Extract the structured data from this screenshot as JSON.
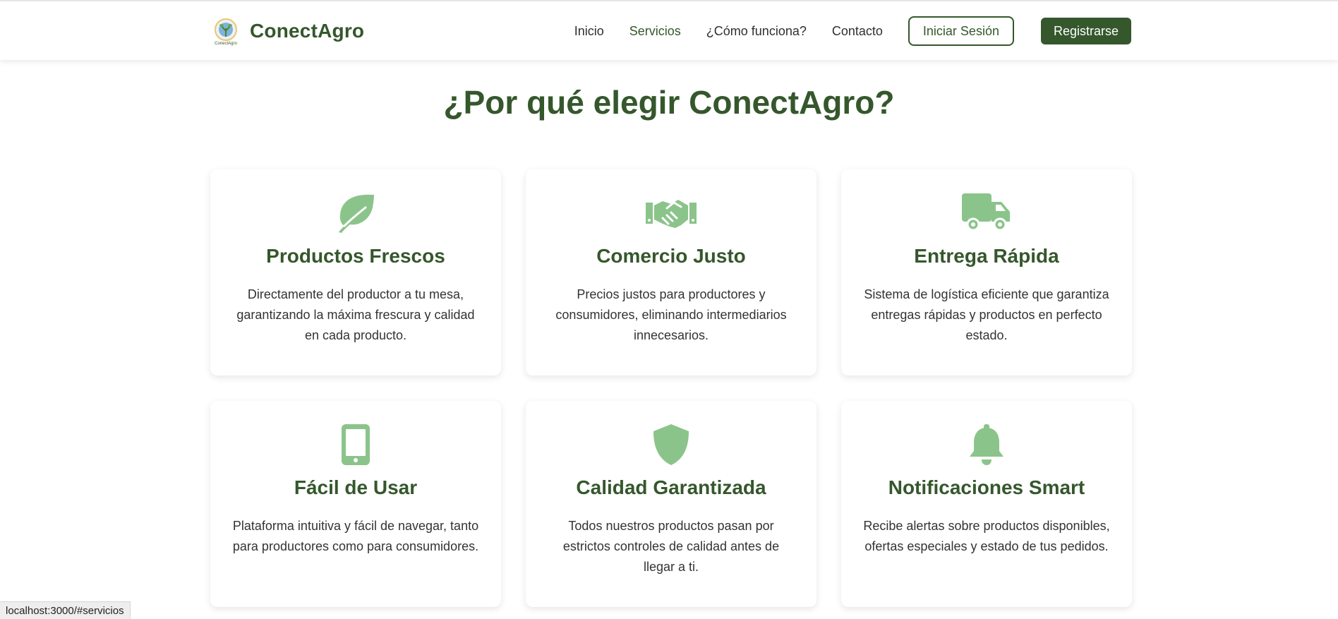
{
  "brand": {
    "name": "ConectAgro",
    "logo_text": "ConectAgro"
  },
  "nav": {
    "links": [
      "Inicio",
      "Servicios",
      "¿Cómo funciona?",
      "Contacto"
    ],
    "active": "Servicios",
    "login_label": "Iniciar Sesión",
    "register_label": "Registrarse"
  },
  "section": {
    "title": "¿Por qué elegir ConectAgro?",
    "cards": [
      {
        "icon": "leaf-icon",
        "title": "Productos Frescos",
        "text": "Directamente del productor a tu mesa, garantizando la máxima frescura y calidad en cada producto."
      },
      {
        "icon": "handshake-icon",
        "title": "Comercio Justo",
        "text": "Precios justos para productores y consumidores, eliminando intermediarios innecesarios."
      },
      {
        "icon": "truck-icon",
        "title": "Entrega Rápida",
        "text": "Sistema de logística eficiente que garantiza entregas rápidas y productos en perfecto estado."
      },
      {
        "icon": "mobile-icon",
        "title": "Fácil de Usar",
        "text": "Plataforma intuitiva y fácil de navegar, tanto para productores como para consumidores."
      },
      {
        "icon": "shield-icon",
        "title": "Calidad Garantizada",
        "text": "Todos nuestros productos pasan por estrictos controles de calidad antes de llegar a ti."
      },
      {
        "icon": "bell-icon",
        "title": "Notificaciones Smart",
        "text": "Recibe alertas sobre productos disponibles, ofertas especiales y estado de tus pedidos."
      }
    ]
  },
  "status_bar": {
    "url": "localhost:3000/#servicios"
  },
  "colors": {
    "brand_green": "#35572c",
    "icon_green": "#8bc48a"
  }
}
